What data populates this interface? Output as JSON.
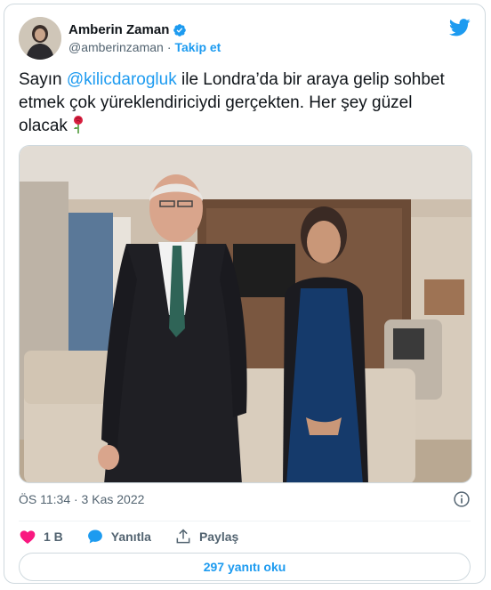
{
  "author": {
    "name": "Amberin Zaman",
    "handle": "@amberinzaman",
    "separator": "·",
    "follow_label": "Takip et"
  },
  "tweet": {
    "text_before": "Sayın ",
    "mention": "@kilicdarogluk",
    "text_after": " ile Londra’da bir araya gelip sohbet etmek çok yüreklendiriciydi  gerçekten. Her şey güzel olacak",
    "emoji": "rose-icon"
  },
  "meta": {
    "timestamp": "ÖS 11:34 · 3 Kas 2022"
  },
  "actions": {
    "like_count": "1 B",
    "reply_label": "Yanıtla",
    "share_label": "Paylaş"
  },
  "replies_button": "297 yanıtı oku",
  "colors": {
    "accent": "#1d9bf0",
    "like": "#f91880",
    "text": "#0f1419",
    "secondary": "#536471"
  }
}
